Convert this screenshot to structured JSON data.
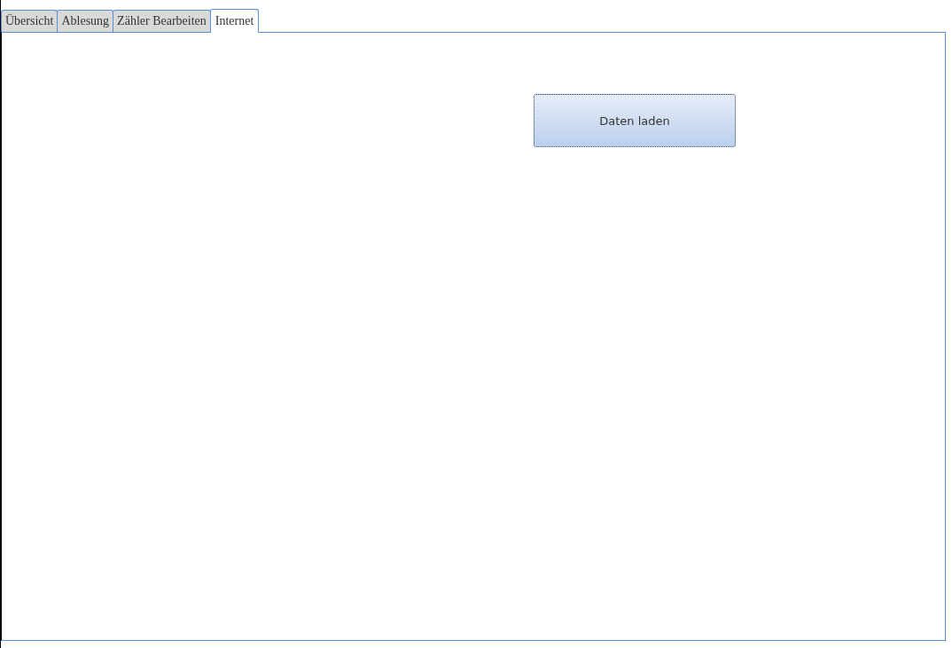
{
  "tabs": [
    {
      "label": "Übersicht",
      "selected": false
    },
    {
      "label": "Ablesung",
      "selected": false
    },
    {
      "label": "Zähler Bearbeiten",
      "selected": false
    },
    {
      "label": "Internet",
      "selected": true
    }
  ],
  "panel": {
    "button": "Daten laden"
  }
}
